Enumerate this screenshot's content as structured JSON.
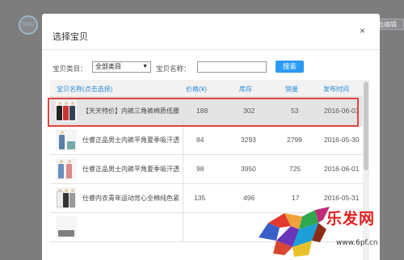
{
  "background": {
    "badge_text": "SKU",
    "edit_button": "出编辑"
  },
  "modal": {
    "title": "选择宝贝",
    "close_symbol": "×"
  },
  "filters": {
    "category_label": "宝贝类目：",
    "category_selected": "全部类目",
    "name_label": "宝贝名称：",
    "name_value": "",
    "search_button": "搜索"
  },
  "table": {
    "headers": {
      "name": "宝贝名称(点击选择)",
      "price": "价格(¥)",
      "stock": "库存",
      "sales": "销量",
      "date": "发布时间"
    },
    "rows": [
      {
        "title": "【天天特价】内裤三角裤棉质低腰",
        "price": "188",
        "stock": "302",
        "sales": "53",
        "date": "2016-06-03"
      },
      {
        "title": "仕睿正品男士内裤平角夏季吸汗透",
        "price": "84",
        "stock": "3293",
        "sales": "2799",
        "date": "2016-05-30"
      },
      {
        "title": "仕睿正品男士内裤平角夏季吸汗透",
        "price": "98",
        "stock": "3950",
        "sales": "725",
        "date": "2016-06-01"
      },
      {
        "title": "仕睿内衣青年运动背心全棉纯色紧",
        "price": "135",
        "stock": "496",
        "sales": "17",
        "date": "2016-05-31"
      },
      {
        "title": "",
        "price": "",
        "stock": "",
        "sales": "",
        "date": ""
      }
    ],
    "selected_row": 0
  },
  "watermark": {
    "brand": "乐发网",
    "url": "www.6pf.cn"
  },
  "colors": {
    "accent": "#2b9af3",
    "highlight": "#e0453f",
    "header_text": "#2b8bd6",
    "overlay": "#7d7d7d"
  },
  "icons": {
    "close": "close-icon",
    "dropdown": "chevron-down-icon",
    "logo": "bull-logo-icon"
  }
}
